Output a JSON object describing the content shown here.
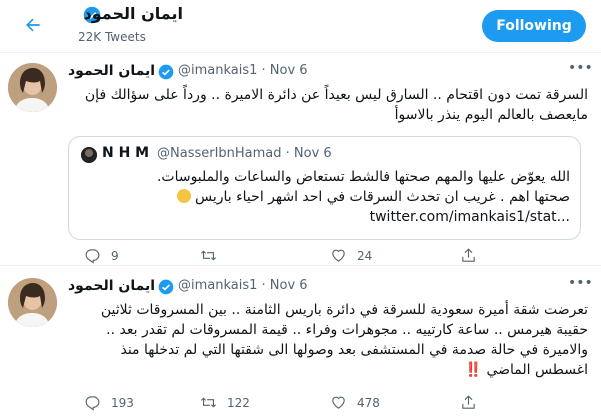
{
  "header": {
    "name": "ايمان الحمود",
    "tweet_count": "22K Tweets",
    "follow_label": "Following"
  },
  "tweets": [
    {
      "name": "ايمان الحمود",
      "handle": "@imankais1 · Nov 6",
      "text": "السرقة تمت دون اقتحام .. السارق ليس بعيداً عن دائرة الاميرة .. ورداً على سؤالك فإن مايعصف بالعالم اليوم ينذر بالاسوأ",
      "quote": {
        "name": "N H M",
        "handle": "@NasserIbnHamad · Nov 6",
        "line1": "الله يعوّض عليها والمهم صحتها فالشط تستعاض والساعات والملبوسات.",
        "line2": "صحتها اهم . غريب ان تحدث السرقات في احد اشهر احياء باريس",
        "link": "twitter.com/imankais1/stat...",
        "emoji": "thinking-face"
      },
      "actions": {
        "reply": "9",
        "retweet": "",
        "like": "24"
      }
    },
    {
      "name": "ايمان الحمود",
      "handle": "@imankais1 · Nov 6",
      "text": "تعرضت شقة أميرة سعودية للسرقة في دائرة باريس الثامنة .. بين المسروقات ثلاثين حقيبة هيرمس .. ساعة كارتييه .. مجوهرات وفراء .. قيمة المسروقات لم تقدر بعد .. والاميرة في حالة صدمة في المستشفى بعد وصولها الى شقتها التي لم تدخلها منذ اغسطس الماضي",
      "text_suffix": "‼️",
      "actions": {
        "reply": "193",
        "retweet": "122",
        "like": "478"
      }
    }
  ],
  "colors": {
    "accent": "#1d9bf0",
    "muted": "#536471",
    "border": "#eff3f4"
  }
}
